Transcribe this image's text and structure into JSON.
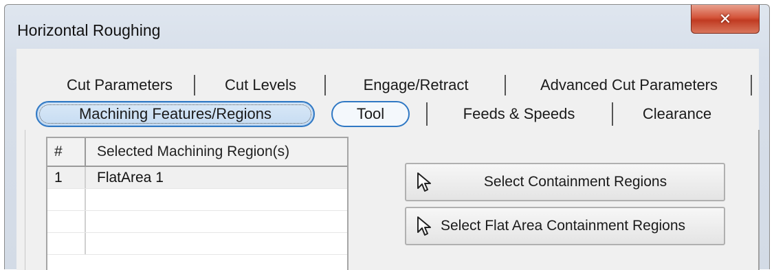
{
  "window": {
    "title": "Horizontal Roughing",
    "close_glyph": "✕"
  },
  "tabs": {
    "row1": [
      {
        "label": "Cut Parameters"
      },
      {
        "label": "Cut Levels"
      },
      {
        "label": "Engage/Retract"
      },
      {
        "label": "Advanced Cut Parameters"
      }
    ],
    "row2": [
      {
        "label": "Machining Features/Regions",
        "selected": true
      },
      {
        "label": "Tool",
        "highlighted": true
      },
      {
        "label": "Feeds & Speeds"
      },
      {
        "label": "Clearance"
      }
    ]
  },
  "region_table": {
    "columns": [
      "#",
      "Selected Machining Region(s)"
    ],
    "rows": [
      {
        "num": "1",
        "name": "FlatArea 1"
      }
    ]
  },
  "buttons": {
    "select_containment": "Select Containment Regions",
    "select_flat_containment": "Select Flat Area Containment Regions",
    "icon": "cursor-arrow-icon"
  },
  "colors": {
    "accent": "#2f78c4",
    "close": "#c03b22"
  }
}
